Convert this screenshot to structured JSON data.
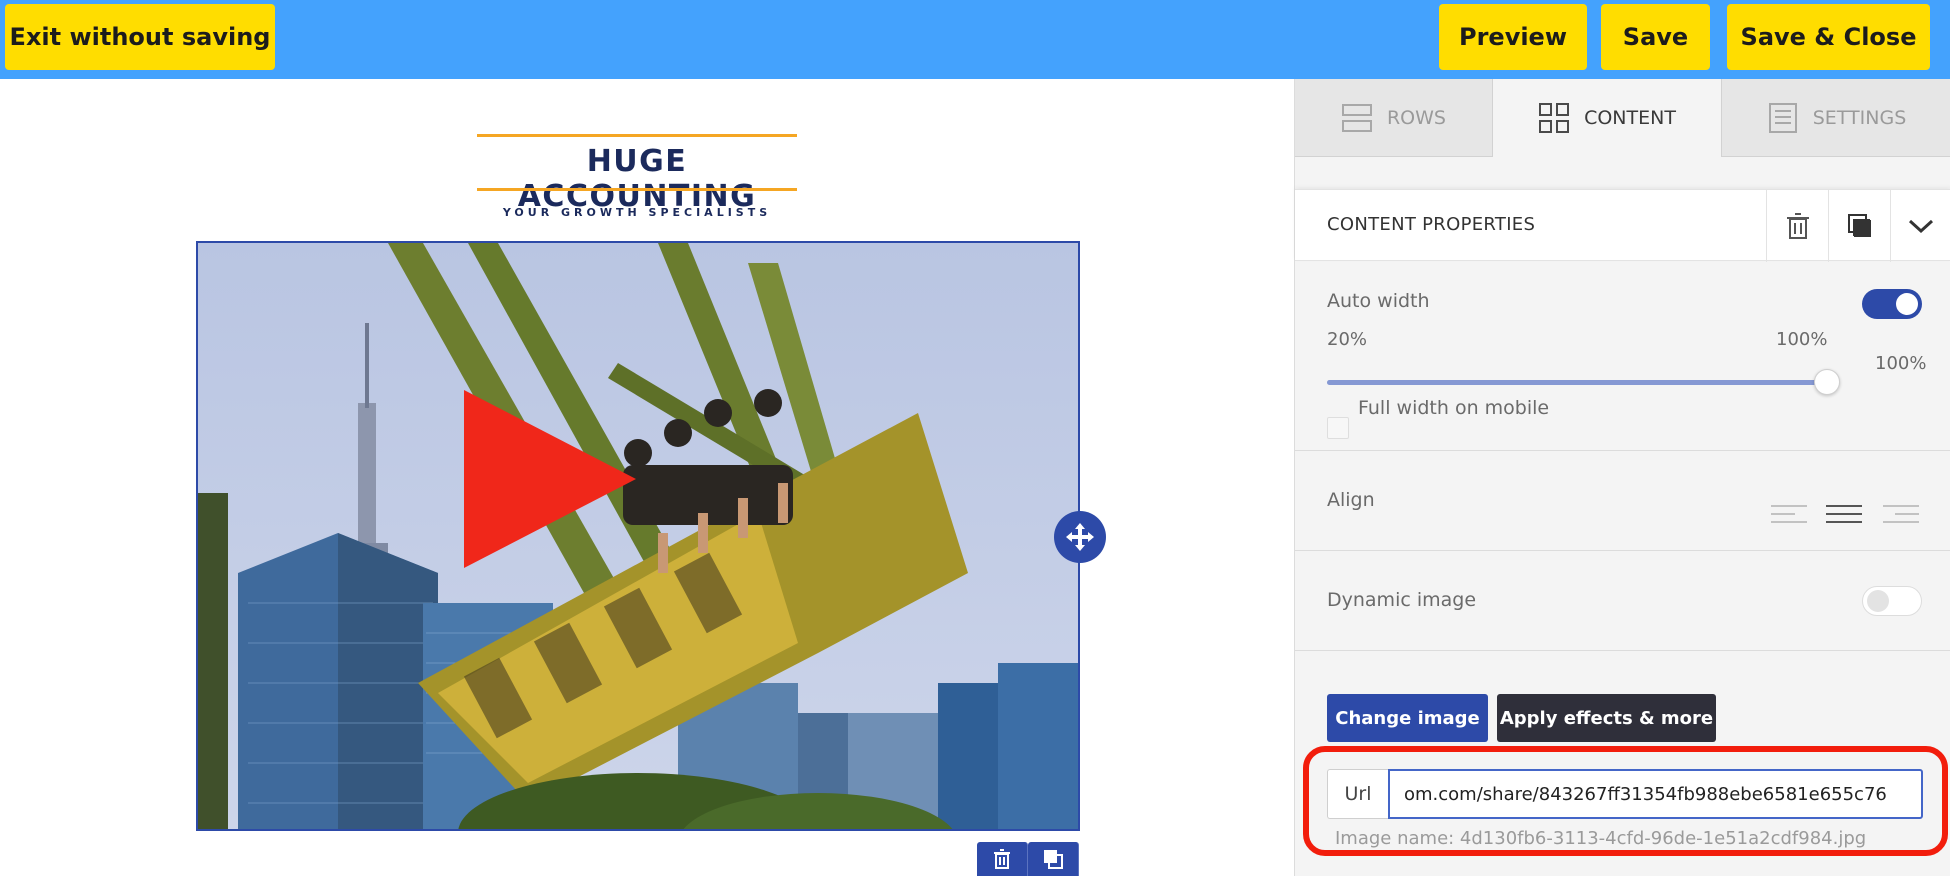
{
  "topbar": {
    "exit_label": "Exit without saving",
    "preview_label": "Preview",
    "save_label": "Save",
    "save_close_label": "Save & Close",
    "bg_color": "#44a2fd",
    "button_color": "#ffdd00"
  },
  "canvas": {
    "logo": {
      "name": "HUGE ACCOUNTING",
      "tagline": "YOUR GROWTH SPECIALISTS"
    },
    "image": {
      "alt_description_icon": "play-icon",
      "move_handle_icon": "move-arrows-icon",
      "tools": [
        "trash-icon",
        "duplicate-icon"
      ]
    }
  },
  "panel": {
    "tabs": [
      {
        "label": "ROWS",
        "icon": "rows-icon",
        "active": false
      },
      {
        "label": "CONTENT",
        "icon": "content-grid-icon",
        "active": true
      },
      {
        "label": "SETTINGS",
        "icon": "settings-icon",
        "active": false
      }
    ],
    "header": {
      "title": "CONTENT PROPERTIES",
      "actions": [
        "trash-icon",
        "duplicate-icon",
        "chevron-down-icon"
      ]
    },
    "auto_width": {
      "label": "Auto width",
      "enabled": true,
      "min_label": "20%",
      "max_label": "100%",
      "value_label": "100%",
      "value": 100
    },
    "full_width_mobile": {
      "label": "Full width on mobile",
      "checked": false
    },
    "align": {
      "label": "Align",
      "options": [
        "align-left-icon",
        "align-center-icon",
        "align-right-icon"
      ],
      "selected": "align-center-icon"
    },
    "dynamic_image": {
      "label": "Dynamic image",
      "enabled": false
    },
    "buttons": {
      "change_image": "Change image",
      "apply_effects": "Apply effects & more"
    },
    "url": {
      "label": "Url",
      "value": "om.com/share/843267ff31354fb988ebe6581e655c76"
    },
    "image_name": "Image name:  4d130fb6-3113-4cfd-96de-1e51a2cdf984.jpg",
    "accent_color": "#2d4aa8",
    "highlight_color": "#f21d0c"
  }
}
